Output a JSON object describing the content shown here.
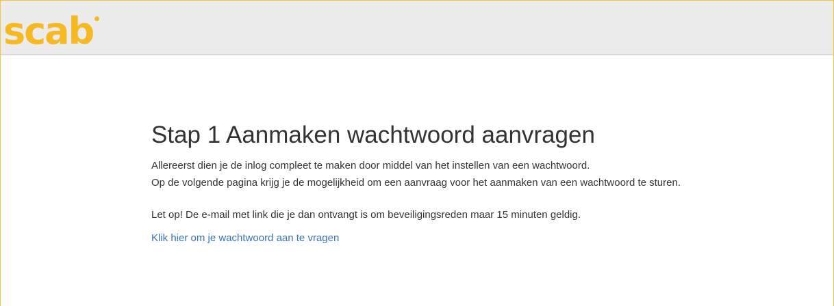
{
  "brand": {
    "logo_text": "scab",
    "accent_color": "#f6b921"
  },
  "main": {
    "title": "Stap 1 Aanmaken wachtwoord aanvragen",
    "intro_line_1": "Allereerst dien je de inlog compleet te maken door middel van het instellen van een wachtwoord.",
    "intro_line_2": "Op de volgende pagina krijg je de mogelijkheid om een aanvraag voor het aanmaken van een wachtwoord te sturen.",
    "note": "Let op! De e-mail met link die je dan ontvangt is om beveiligingsreden maar 15 minuten geldig.",
    "link_label": "Klik hier om je wachtwoord aan te vragen"
  }
}
